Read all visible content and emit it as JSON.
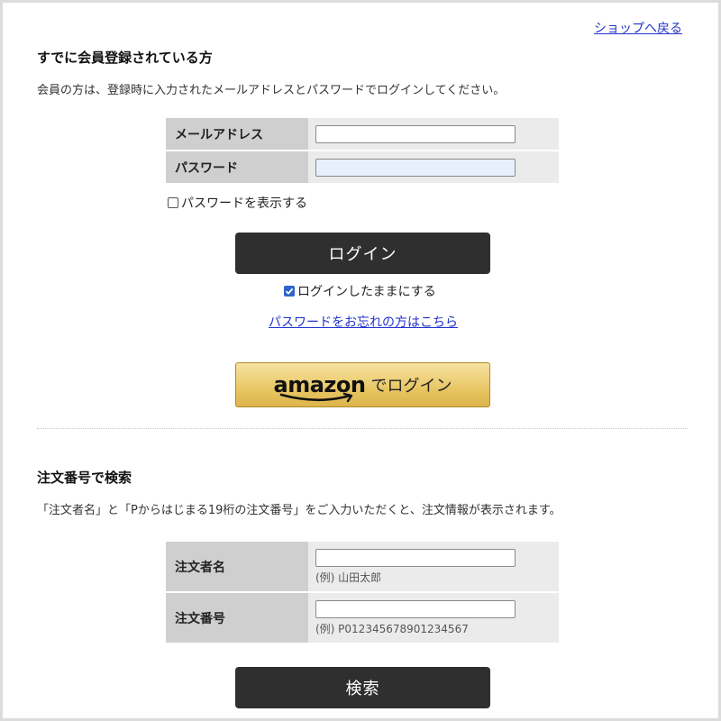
{
  "header": {
    "back_link": "ショップへ戻る"
  },
  "member_login": {
    "title": "すでに会員登録されている方",
    "description": "会員の方は、登録時に入力されたメールアドレスとパスワードでログインしてください。",
    "email_label": "メールアドレス",
    "email_value": "",
    "password_label": "パスワード",
    "password_value": "",
    "show_password_label": "パスワードを表示する",
    "show_password_checked": false,
    "login_button": "ログイン",
    "remember_label": "ログインしたままにする",
    "remember_checked": true,
    "forgot_link": "パスワードをお忘れの方はこちら"
  },
  "amazon_login": {
    "logo_text": "amazon",
    "label": "でログイン",
    "logo_icon": "amazon-smile-arrow"
  },
  "order_search": {
    "title": "注文番号で検索",
    "description": "「注文者名」と「Pからはじまる19桁の注文番号」をご入力いただくと、注文情報が表示されます。",
    "name_label": "注文者名",
    "name_value": "",
    "name_hint": "(例) 山田太郎",
    "number_label": "注文番号",
    "number_value": "",
    "number_hint": "(例) P012345678901234567",
    "search_button": "検索"
  },
  "colors": {
    "button_dark": "#2f2f2f",
    "link_blue": "#2233cc",
    "header_cell": "#cfcfcf",
    "value_cell": "#ebebeb",
    "amazon_gold": "#e8c664",
    "checkbox_checked": "#2f63c8"
  }
}
